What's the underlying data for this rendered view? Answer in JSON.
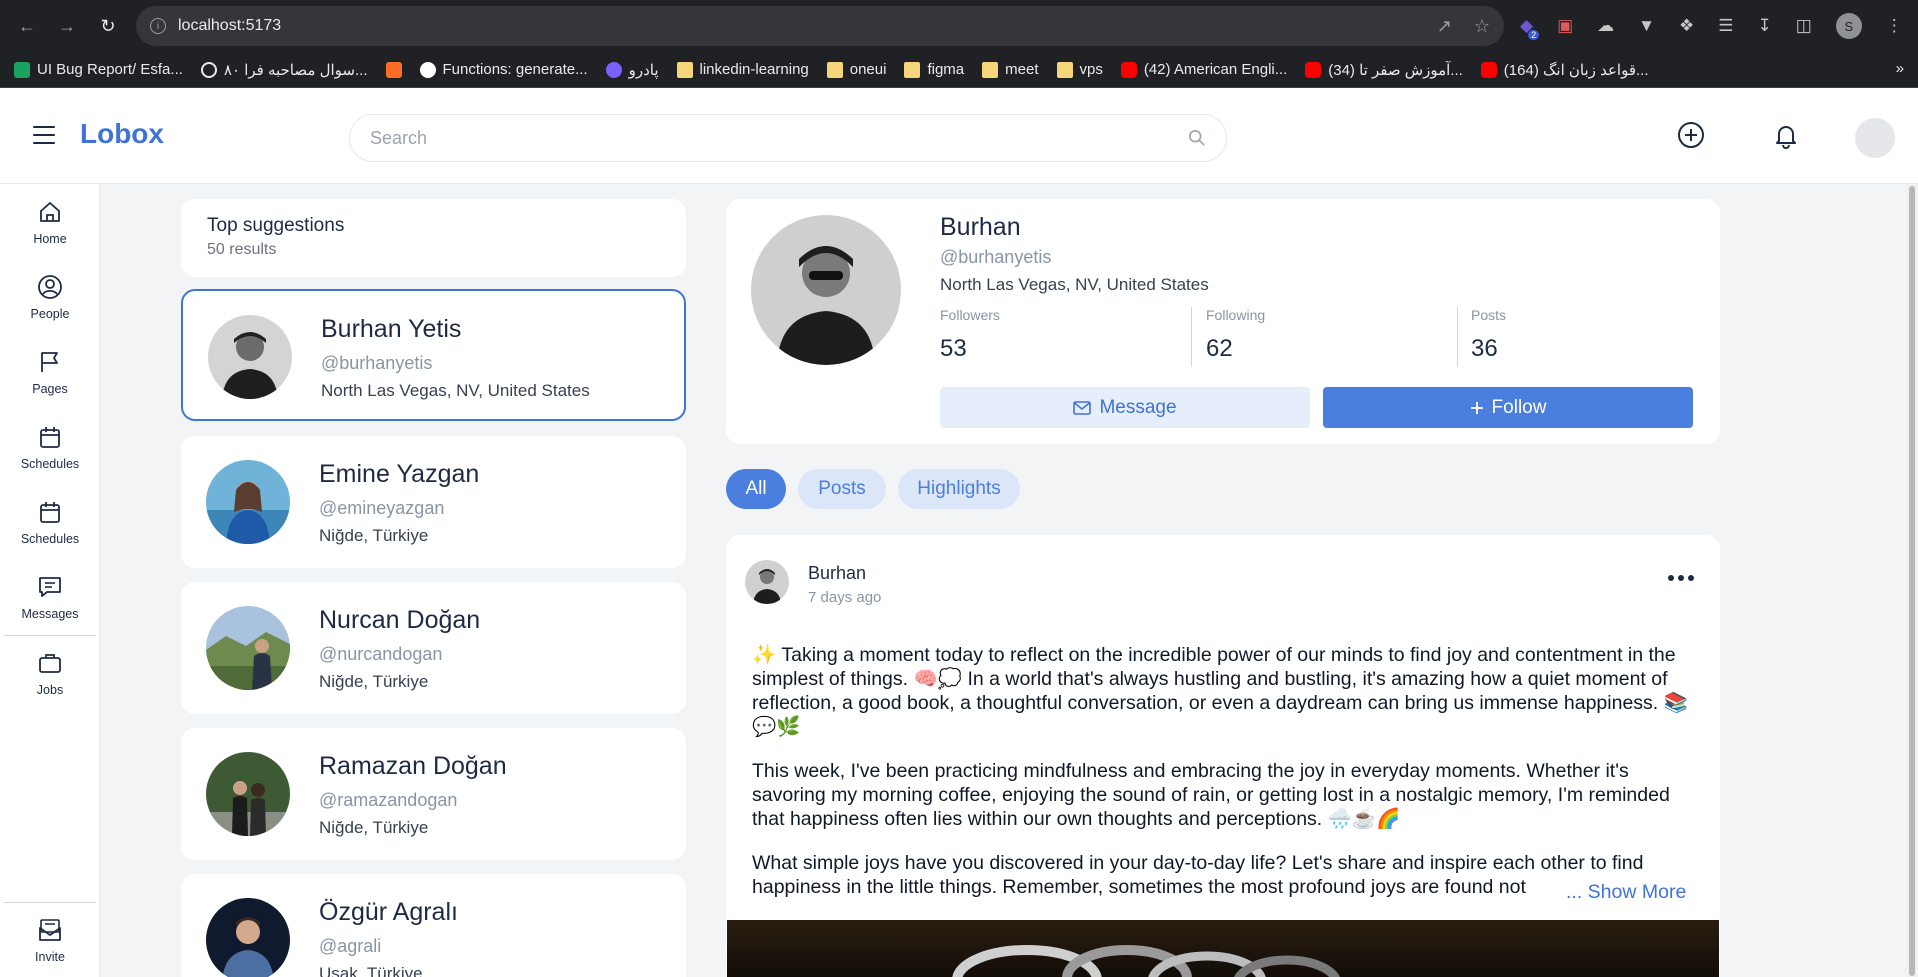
{
  "browser": {
    "url": "localhost:5173",
    "profile_initial": "S",
    "extension_badge": "2",
    "bookmarks": [
      {
        "label": "UI Bug Report/ Esfa...",
        "icon": "green"
      },
      {
        "label": "۸۰ سوال مصاحبه فرا...",
        "icon": "moon"
      },
      {
        "label": "",
        "icon": "gl"
      },
      {
        "label": "Functions: generate...",
        "icon": "n"
      },
      {
        "label": "پادرو",
        "icon": "p"
      },
      {
        "label": "linkedin-learning",
        "icon": "folder"
      },
      {
        "label": "oneui",
        "icon": "folder"
      },
      {
        "label": "figma",
        "icon": "folder"
      },
      {
        "label": "meet",
        "icon": "folder"
      },
      {
        "label": "vps",
        "icon": "folder"
      },
      {
        "label": "(42) American Engli...",
        "icon": "yt"
      },
      {
        "label": "(34) آموزش صفر تا...",
        "icon": "yt"
      },
      {
        "label": "(164) قواعد زبان انگ...",
        "icon": "yt"
      }
    ],
    "overflow": "»"
  },
  "header": {
    "logo": "Lobox",
    "search_placeholder": "Search"
  },
  "rail": {
    "items": [
      {
        "label": "Home",
        "icon": "home-icon"
      },
      {
        "label": "People",
        "icon": "user-circle-icon"
      },
      {
        "label": "Pages",
        "icon": "flag-icon"
      },
      {
        "label": "Schedules",
        "icon": "calendar-icon"
      },
      {
        "label": "Schedules",
        "icon": "calendar-icon"
      },
      {
        "label": "Messages",
        "icon": "message-icon"
      },
      {
        "label": "Jobs",
        "icon": "briefcase-icon"
      }
    ],
    "invite": "Invite"
  },
  "suggestions": {
    "title": "Top suggestions",
    "count": "50 results",
    "people": [
      {
        "name": "Burhan Yetis",
        "username": "@burhanyetis",
        "location": "North Las Vegas, NV, United States"
      },
      {
        "name": "Emine Yazgan",
        "username": "@emineyazgan",
        "location": "Niğde, Türkiye"
      },
      {
        "name": "Nurcan Doğan",
        "username": "@nurcandogan",
        "location": "Niğde, Türkiye"
      },
      {
        "name": "Ramazan Doğan",
        "username": "@ramazandogan",
        "location": "Niğde, Türkiye"
      },
      {
        "name": "Özgür Agralı",
        "username": "@agrali",
        "location": "Uşak, Türkiye"
      }
    ]
  },
  "profile": {
    "name": "Burhan",
    "username": "@burhanyetis",
    "location": "North Las Vegas, NV, United States",
    "stats": [
      {
        "label": "Followers",
        "value": "53"
      },
      {
        "label": "Following",
        "value": "62"
      },
      {
        "label": "Posts",
        "value": "36"
      }
    ],
    "message_label": "Message",
    "follow_label": "Follow"
  },
  "tabs": [
    "All",
    "Posts",
    "Highlights"
  ],
  "post": {
    "author": "Burhan",
    "time": "7 days ago",
    "paragraphs": [
      "✨ Taking a moment today to reflect on the incredible power of our minds to find joy and contentment in the simplest of things. 🧠💭 In a world that's always hustling and bustling, it's amazing how a quiet moment of reflection, a good book, a thoughtful conversation, or even a daydream can bring us immense happiness. 📚💬🌿",
      "This week, I've been practicing mindfulness and embracing the joy in everyday moments. Whether it's savoring my morning coffee, enjoying the sound of rain, or getting lost in a nostalgic memory, I'm reminded that happiness often lies within our own thoughts and perceptions. 🌧️☕🌈",
      "What simple joys have you discovered in your day-to-day life? Let's share and inspire each other to find happiness in the little things. Remember, sometimes the most profound joys are found not"
    ],
    "show_more": "... Show More"
  }
}
